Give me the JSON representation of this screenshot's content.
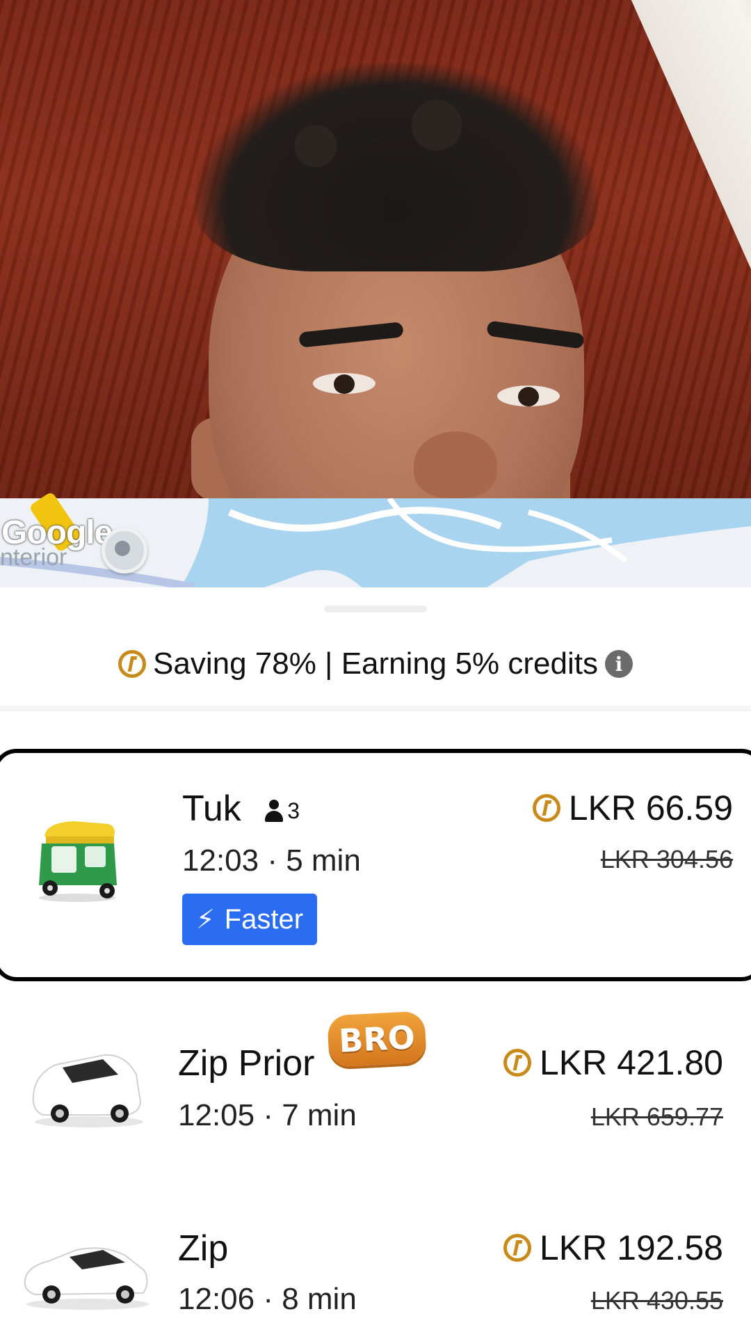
{
  "map": {
    "google_logo": "Google",
    "area_label": "nterior"
  },
  "savings_banner": {
    "text": "Saving 78% | Earning 5% credits"
  },
  "colors": {
    "credit_coin": "#c88a1a",
    "faster_badge": "#2a6df0",
    "selected_border": "#000000"
  },
  "rides": [
    {
      "name": "Tuk",
      "capacity": "3",
      "eta": "12:03 · 5 min",
      "price": "LKR 66.59",
      "original_price": "LKR 304.56",
      "badge": "Faster",
      "selected": true,
      "vehicle_icon": "tuk-tuk-icon"
    },
    {
      "name": "Zip Prior",
      "eta": "12:05 · 7 min",
      "price": "LKR 421.80",
      "original_price": "LKR 659.77",
      "selected": false,
      "vehicle_icon": "minivan-icon"
    },
    {
      "name": "Zip",
      "eta": "12:06 · 8 min",
      "price": "LKR 192.58",
      "original_price": "LKR 430.55",
      "selected": false,
      "vehicle_icon": "car-icon"
    }
  ],
  "overlay_sticker": "BRO"
}
